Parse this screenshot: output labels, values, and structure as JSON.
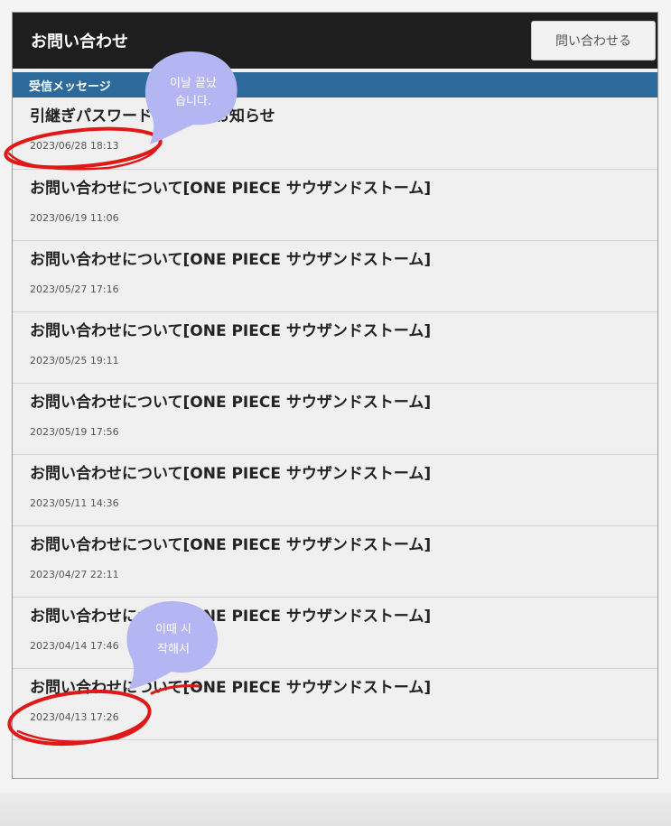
{
  "header": {
    "title": "お問い合わせ",
    "contact_button": "問い合わせる"
  },
  "section": {
    "label": "受信メッセージ"
  },
  "messages": [
    {
      "title": "引継ぎパスワード再発行のお知らせ",
      "date": "2023/06/28 18:13"
    },
    {
      "title": "お問い合わせについて[ONE PIECE サウザンドストーム]",
      "date": "2023/06/19 11:06"
    },
    {
      "title": "お問い合わせについて[ONE PIECE サウザンドストーム]",
      "date": "2023/05/27 17:16"
    },
    {
      "title": "お問い合わせについて[ONE PIECE サウザンドストーム]",
      "date": "2023/05/25 19:11"
    },
    {
      "title": "お問い合わせについて[ONE PIECE サウザンドストーム]",
      "date": "2023/05/19 17:56"
    },
    {
      "title": "お問い合わせについて[ONE PIECE サウザンドストーム]",
      "date": "2023/05/11 14:36"
    },
    {
      "title": "お問い合わせについて[ONE PIECE サウザンドストーム]",
      "date": "2023/04/27 22:11"
    },
    {
      "title": "お問い合わせについて[ONE PIECE サウザンドストーム]",
      "date": "2023/04/14 17:46"
    },
    {
      "title": "お問い合わせについて[ONE PIECE サウザンドストーム]",
      "date": "2023/04/13 17:26"
    }
  ],
  "annotations": {
    "top_note_line1": "이날 끝났",
    "top_note_line2": "습니다.",
    "bottom_note_line1": "이때 시",
    "bottom_note_line2": "작해서",
    "bubble_color": "#b4b6f4",
    "circle_color": "#e01818"
  }
}
